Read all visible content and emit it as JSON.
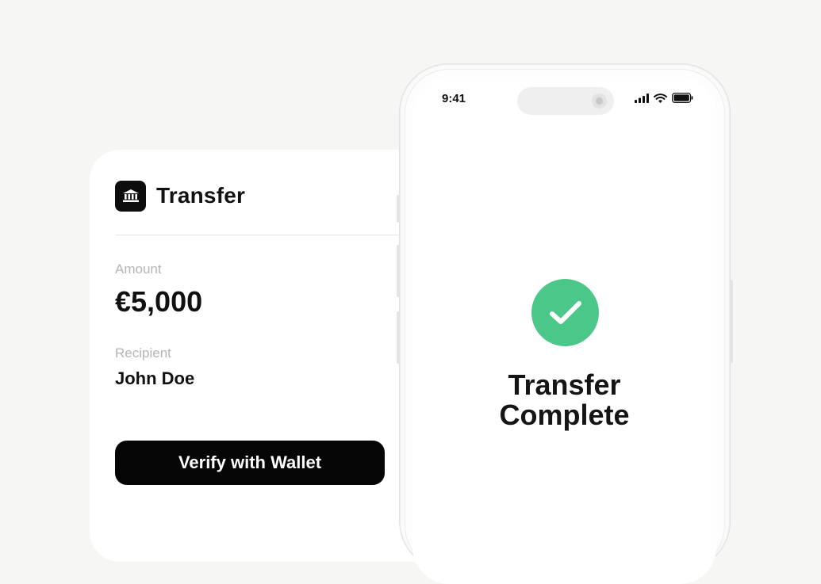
{
  "transfer_card": {
    "title": "Transfer",
    "icon": "bank-icon",
    "amount_label": "Amount",
    "amount_value": "€5,000",
    "recipient_label": "Recipient",
    "recipient_value": "John Doe",
    "verify_button_label": "Verify with Wallet"
  },
  "phone": {
    "status_bar": {
      "time": "9:41",
      "icons": [
        "signal-icon",
        "wifi-icon",
        "battery-icon"
      ]
    },
    "success_icon": "checkmark-icon",
    "message_line1": "Transfer",
    "message_line2": "Complete"
  },
  "colors": {
    "background": "#f6f6f4",
    "success_green": "#4cc78a",
    "button_black": "#050505",
    "label_gray": "#b5b5b5"
  }
}
